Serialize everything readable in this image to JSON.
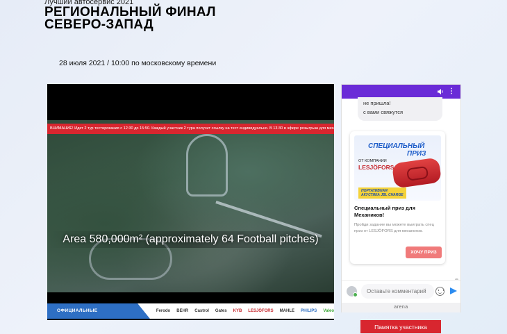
{
  "header": {
    "subtitle": "Лучший автосервис 2021",
    "title_line1": "РЕГИОНАЛЬНЫЙ ФИНАЛ",
    "title_line2": "СЕВЕРО-ЗАПАД",
    "date": "28 июля 2021 / 10:00 по московскому времени"
  },
  "video": {
    "warning": "ВНИМАНИЕ! Идет 2 тур тестирования с 12:30 до 15:50. Каждый участник 2 тура получит ссылку на тест индивидуально. В 13:30 в эфире розыгрыш для механиков",
    "caption": "Area 580,000m² (approximately 64 Football pitches)",
    "partners_label": "ОФИЦИАЛЬНЫЕ ПАРТНЕРЫ",
    "partners": [
      "Ferodo",
      "BEHR",
      "Castrol",
      "Gates",
      "KYB",
      "LESJÖFORS",
      "MAHLE",
      "PHILIPS",
      "Valeo"
    ]
  },
  "chat": {
    "bubble_line1": "не пришла!",
    "bubble_line2": "с вами свяжутся",
    "promo": {
      "image_line1": "СПЕЦИАЛЬНЫЙ",
      "image_line2": "ПРИЗ",
      "image_from": "ОТ КОМПАНИИ",
      "image_brand": "LESJÖFORS",
      "image_tag_line1": "ПОРТАТИВНАЯ",
      "image_tag_line2": "АКУСТИКА JBL CHARGE",
      "title": "Специальный приз для Механиков!",
      "text": "Пройди задание вы можете выиграть спец приз от LESJÖFORS для механиков.",
      "button": "ХОЧУ ПРИЗ"
    },
    "input_placeholder": "Оставьте комментарий",
    "footer": "arena",
    "header_color": "#6a2bd7"
  },
  "memo_button": "Памятка участника",
  "accent_color": "#d8262f"
}
